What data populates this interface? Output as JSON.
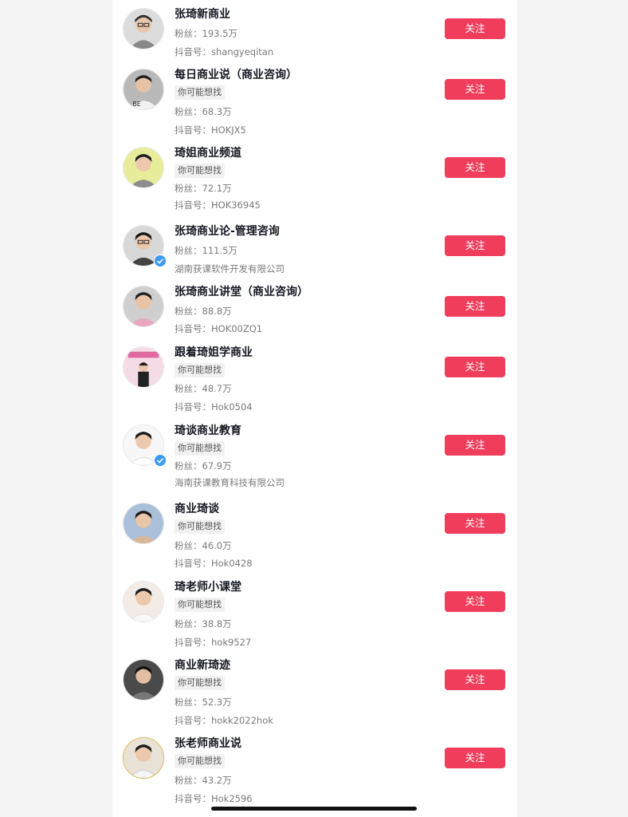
{
  "accent_color": "#f03d5b",
  "tag_label": "你可能想找",
  "follow_label": "关注",
  "accounts": [
    {
      "name": "张琦新商业",
      "fans": "粉丝：193.5万",
      "id_line": "抖音号：shangyeqitan"
    },
    {
      "name": "每日商业说（商业咨询）",
      "tag": "你可能想找",
      "fans": "粉丝：68.3万",
      "id_line": "抖音号：HOKJX5"
    },
    {
      "name": "琦姐商业频道",
      "tag": "你可能想找",
      "fans": "粉丝：72.1万",
      "id_line": "抖音号：HOK36945"
    },
    {
      "name": "张琦商业论-管理咨询",
      "fans": "粉丝：111.5万",
      "id_line": "湖南获课软件开发有限公司",
      "verified": true
    },
    {
      "name": "张琦商业讲堂（商业咨询）",
      "fans": "粉丝：88.8万",
      "id_line": "抖音号：HOK00ZQ1"
    },
    {
      "name": "跟着琦姐学商业",
      "tag": "你可能想找",
      "fans": "粉丝：48.7万",
      "id_line": "抖音号：Hok0504"
    },
    {
      "name": "琦谈商业教育",
      "tag": "你可能想找",
      "fans": "粉丝：67.9万",
      "id_line": "海南获课教育科技有限公司",
      "verified": true
    },
    {
      "name": "商业琦谈",
      "tag": "你可能想找",
      "fans": "粉丝：46.0万",
      "id_line": "抖音号：Hok0428"
    },
    {
      "name": "琦老师小课堂",
      "tag": "你可能想找",
      "fans": "粉丝：38.8万",
      "id_line": "抖音号：hok9527"
    },
    {
      "name": "商业新琦迹",
      "tag": "你可能想找",
      "fans": "粉丝：52.3万",
      "id_line": "抖音号：hokk2022hok"
    },
    {
      "name": "张老师商业说",
      "tag": "你可能想找",
      "fans": "粉丝：43.2万",
      "id_line": "抖音号：Hok2596"
    }
  ]
}
